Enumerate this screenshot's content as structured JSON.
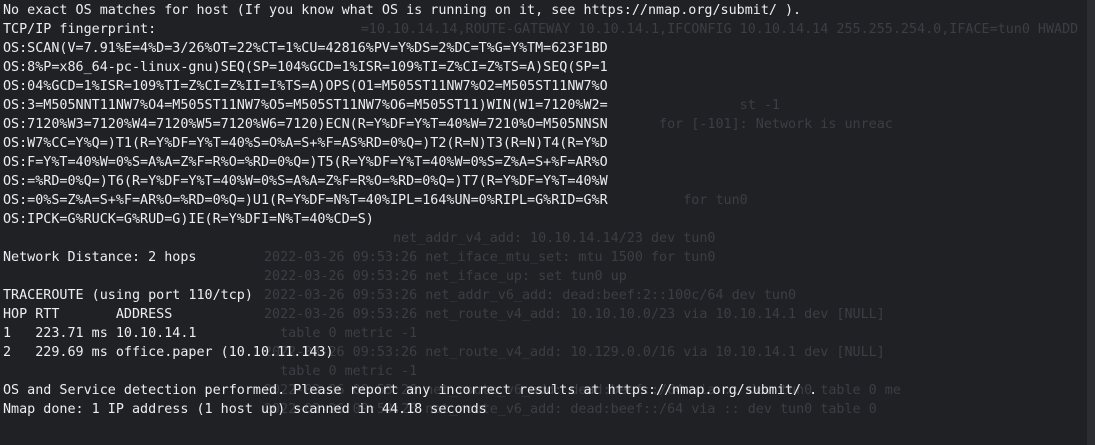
{
  "terminal": {
    "lines": [
      "No exact OS matches for host (If you know what OS is running on it, see https://nmap.org/submit/ ).",
      "TCP/IP fingerprint:",
      "OS:SCAN(V=7.91%E=4%D=3/26%OT=22%CT=1%CU=42816%PV=Y%DS=2%DC=T%G=Y%TM=623F1BD",
      "OS:8%P=x86_64-pc-linux-gnu)SEQ(SP=104%GCD=1%ISR=109%TI=Z%CI=Z%TS=A)SEQ(SP=1",
      "OS:04%GCD=1%ISR=109%TI=Z%CI=Z%II=I%TS=A)OPS(O1=M505ST11NW7%O2=M505ST11NW7%O",
      "OS:3=M505NNT11NW7%O4=M505ST11NW7%O5=M505ST11NW7%O6=M505ST11)WIN(W1=7120%W2=",
      "OS:7120%W3=7120%W4=7120%W5=7120%W6=7120)ECN(R=Y%DF=Y%T=40%W=7210%O=M505NNSN",
      "OS:W7%CC=Y%Q=)T1(R=Y%DF=Y%T=40%S=O%A=S+%F=AS%RD=0%Q=)T2(R=N)T3(R=N)T4(R=Y%D",
      "OS:F=Y%T=40%W=0%S=A%A=Z%F=R%O=%RD=0%Q=)T5(R=Y%DF=Y%T=40%W=0%S=Z%A=S+%F=AR%O",
      "OS:=%RD=0%Q=)T6(R=Y%DF=Y%T=40%W=0%S=A%A=Z%F=R%O=%RD=0%Q=)T7(R=Y%DF=Y%T=40%W",
      "OS:=0%S=Z%A=S+%F=AR%O=%RD=0%Q=)U1(R=Y%DF=N%T=40%IPL=164%UN=0%RIPL=G%RID=G%R",
      "OS:IPCK=G%RUCK=G%RUD=G)IE(R=Y%DFI=N%T=40%CD=S)",
      "",
      "Network Distance: 2 hops",
      "",
      "TRACEROUTE (using port 110/tcp)",
      "HOP RTT       ADDRESS",
      "1   223.71 ms 10.10.14.1",
      "2   229.69 ms office.paper (10.10.11.143)",
      "",
      "OS and Service detection performed. Please report any incorrect results at https://nmap.org/submit/ .",
      "Nmap done: 1 IP address (1 host up) scanned in 44.18 seconds"
    ]
  },
  "background_window": {
    "lines": [
      "",
      "            =10.10.14.14,ROUTE-GATEWAY 10.10.14.1,IFCONFIG 10.10.14.14 255.255.254.0,IFACE=tun0 HWADD",
      "",
      "",
      "",
      "                                                           st -1",
      "                                                 for [-101]: Network is unreac",
      "",
      "",
      "",
      "                                                    for tun0",
      "",
      "                net_addr_v4_add: 10.10.14.14/23 dev tun0",
      "2022-03-26 09:53:26 net_iface_mtu_set: mtu 1500 for tun0",
      "2022-03-26 09:53:26 net_iface_up: set tun0 up",
      "2022-03-26 09:53:26 net_addr_v6_add: dead:beef:2::100c/64 dev tun0",
      "2022-03-26 09:53:26 net_route_v4_add: 10.10.10.0/23 via 10.10.14.1 dev [NULL]",
      "  table 0 metric -1",
      "2022-03-26 09:53:26 net_route_v4_add: 10.129.0.0/16 via 10.10.14.1 dev [NULL]",
      "  table 0 metric -1",
      "2022-03-26 09:53:26 net_route_v6_add: dead:beef::/64 via :: dev tun0 table 0 me",
      "2022-03-26 09:53:26 net_route_v6_add: dead:beef::/64 via :: dev tun0 table 0"
    ]
  },
  "colors": {
    "background": "#1f2124",
    "text": "#eceef1",
    "ghost_text": "#3b3e44"
  }
}
